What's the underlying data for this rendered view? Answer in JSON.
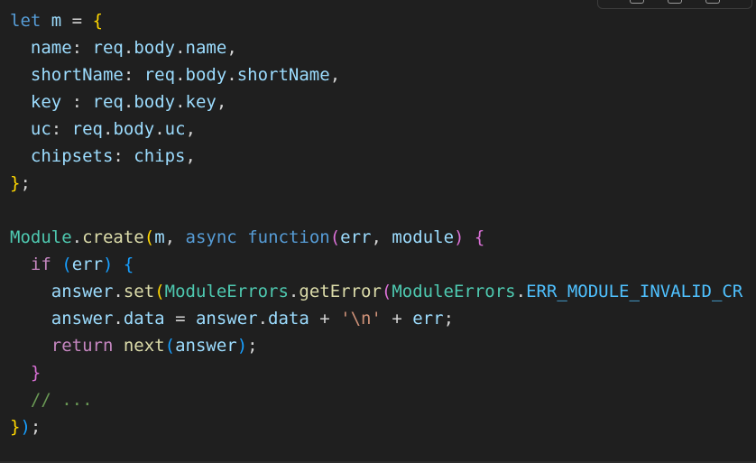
{
  "toolbar": {
    "buttons": [
      "copy-icon",
      "wrap-icon",
      "expand-icon"
    ]
  },
  "code": {
    "language": "javascript",
    "lines": [
      "let m = {",
      "  name: req.body.name,",
      "  shortName: req.body.shortName,",
      "  key : req.body.key,",
      "  uc: req.body.uc,",
      "  chipsets: chips,",
      "};",
      "",
      "Module.create(m, async function(err, module) {",
      "  if (err) {",
      "    answer.set(ModuleErrors.getError(ModuleErrors.ERR_MODULE_INVALID_CR",
      "    answer.data = answer.data + '\\n' + err;",
      "    return next(answer);",
      "  }",
      "  // ...",
      "});"
    ]
  },
  "colors": {
    "background": "#1f1f1f",
    "keyword": "#569cd6",
    "control": "#c586c0",
    "variable": "#9cdcfe",
    "function": "#dcdcaa",
    "class": "#4ec9b0",
    "constant": "#4fc1ff",
    "string": "#ce9178",
    "comment": "#6a9955",
    "bracket1": "#ffd700",
    "bracket2": "#da70d6",
    "bracket3": "#179fff"
  }
}
